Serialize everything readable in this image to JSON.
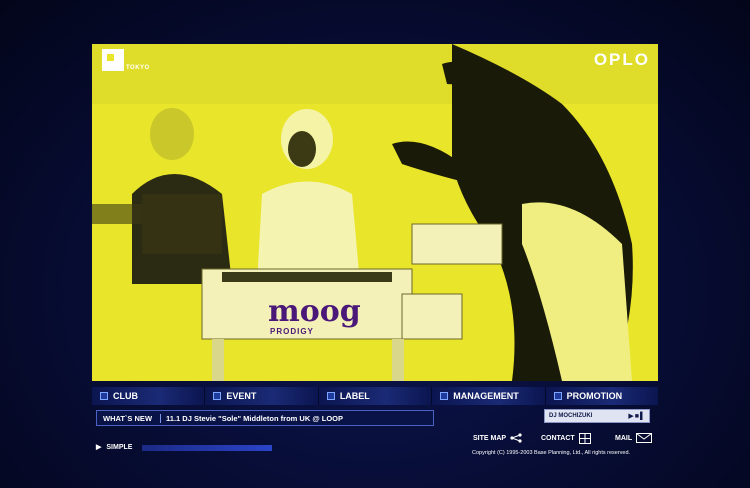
{
  "brand": {
    "left_logo": "TOKYO",
    "right_logo": "OPLO"
  },
  "hero": {
    "instrument_brand": "moog",
    "instrument_model": "PRODIGY"
  },
  "nav": {
    "items": [
      {
        "label": "CLUB"
      },
      {
        "label": "EVENT"
      },
      {
        "label": "LABEL"
      },
      {
        "label": "MANAGEMENT"
      },
      {
        "label": "PROMOTION"
      }
    ]
  },
  "news": {
    "label": "WHAT`S NEW",
    "text": "11.1 DJ Stevie \"Sole\" Middleton from UK @ LOOP"
  },
  "artist_player": {
    "name": "DJ MOCHIZUKI",
    "controls": "▶■▌"
  },
  "simple": {
    "label": "SIMPLE"
  },
  "footer": {
    "site_map": "SITE MAP",
    "contact": "CONTACT",
    "mail": "MAIL",
    "copyright": "Copyright (C) 1995-2003 Base Planning, Ltd., All rights reserved."
  }
}
